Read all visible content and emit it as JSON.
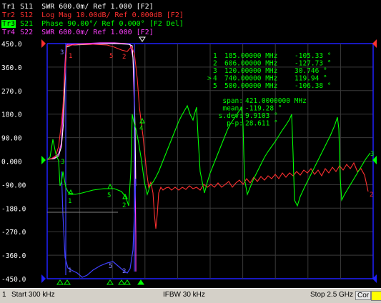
{
  "traces": [
    {
      "id": "Tr1",
      "desc": " S11  SWR 600.0m/ Ref 1.000 [F2]",
      "color": "#ffffff",
      "active": false
    },
    {
      "id": "Tr2",
      "desc": " S12  Log Mag 10.00dB/ Ref 0.000dB [F2]",
      "color": "#ff3030",
      "active": false
    },
    {
      "id": "Tr3",
      "desc": " S21  Phase 90.00°/ Ref 0.000° [F2 Del]",
      "color": "#00ff00",
      "active": true
    },
    {
      "id": "Tr4",
      "desc": " S22  SWR 600.0m/ Ref 1.000 [F2]",
      "color": "#ff40ff",
      "active": false
    }
  ],
  "y_ticks": [
    "450.0",
    "360.0",
    "270.0",
    "180.0",
    "90.00",
    "0.000",
    "-90.00",
    "-180.0",
    "-270.0",
    "-360.0",
    "-450.0"
  ],
  "markers": [
    {
      "n": "1",
      "sym": " ",
      "freq": "185.00000 MHz",
      "val": "-105.33 °"
    },
    {
      "n": "2",
      "sym": " ",
      "freq": "606.00000 MHz",
      "val": "-127.73 °"
    },
    {
      "n": "3",
      "sym": " ",
      "freq": "120.00000 MHz",
      "val": "30.746 °"
    },
    {
      "n": "4",
      "sym": ">",
      "freq": "740.00000 MHz",
      "val": "119.94 °"
    },
    {
      "n": "5",
      "sym": " ",
      "freq": "500.00000 MHz",
      "val": "-106.38 °"
    }
  ],
  "stats": [
    {
      "k": "span:",
      "v": "421.0000000 MHz"
    },
    {
      "k": "mean:",
      "v": "-119.28 °"
    },
    {
      "k": "s.dev:",
      "v": "9.9103 °"
    },
    {
      "k": "p-p:",
      "v": "28.611 °"
    }
  ],
  "status": {
    "channel": "1",
    "start": "Start 300 kHz",
    "ifbw": "IFBW 30 kHz",
    "stop": "Stop 2.5 GHz",
    "cor": "Cor"
  },
  "colors": {
    "grid": "#3a3a3a",
    "frame": "#2020ff",
    "tr1": "#ffffff",
    "tr2": "#ff3030",
    "tr3": "#00ff00",
    "tr4": "#ff40ff"
  }
}
